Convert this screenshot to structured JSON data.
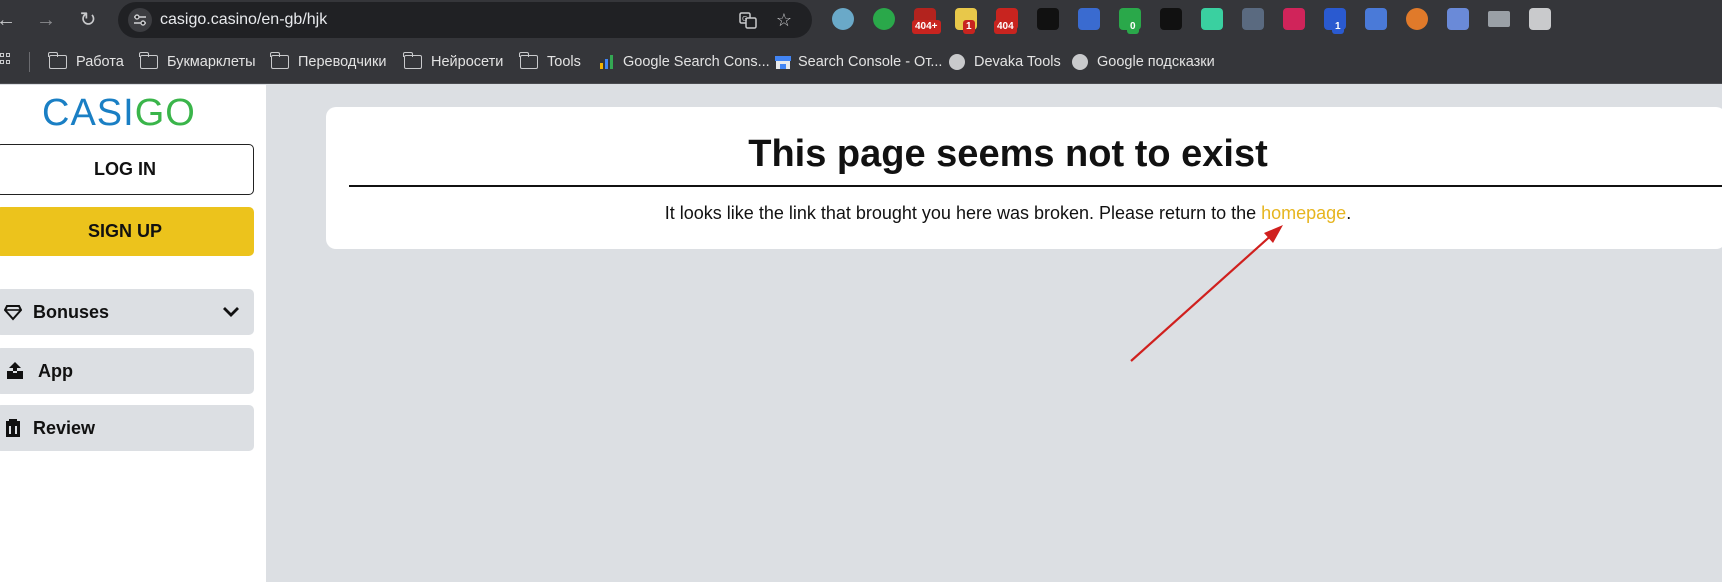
{
  "browser": {
    "url": "casigo.casino/en-gb/hjk",
    "extensions": [
      {
        "name": "ext-hex",
        "color": "#6aa9c8"
      },
      {
        "name": "ext-green-chart",
        "color": "#2aa84a"
      },
      {
        "name": "ext-404plus",
        "color": "#b3231e",
        "badge": "404+"
      },
      {
        "name": "ext-bulb",
        "color": "#e8c84a",
        "badge": "1"
      },
      {
        "name": "ext-404",
        "color": "#c8241f",
        "badge": "404"
      },
      {
        "name": "ext-mask",
        "color": "#111111"
      },
      {
        "name": "ext-magnet",
        "color": "#3a6bd0"
      },
      {
        "name": "ext-green-hook",
        "color": "#2aa84a",
        "badge": "0"
      },
      {
        "name": "ext-eyes",
        "color": "#111111"
      },
      {
        "name": "ext-pk",
        "color": "#3ad0a0"
      },
      {
        "name": "ext-mouse",
        "color": "#5a6a80"
      },
      {
        "name": "ext-shield-u",
        "color": "#d0245a"
      },
      {
        "name": "ext-shield-1",
        "color": "#2a5ad0",
        "badge": "1"
      },
      {
        "name": "ext-undo",
        "color": "#4a7ad8"
      },
      {
        "name": "ext-colorwheel",
        "color": "#e07a2a"
      },
      {
        "name": "ext-link",
        "color": "#6a8ad8"
      },
      {
        "name": "ext-mail",
        "color": "#9aa0a6"
      },
      {
        "name": "ext-puzzle",
        "color": "#c9cacc"
      }
    ]
  },
  "bookmarks": [
    {
      "label": "Работа",
      "icon": "folder-icon"
    },
    {
      "label": "Букмарклеты",
      "icon": "folder-icon"
    },
    {
      "label": "Переводчики",
      "icon": "folder-icon"
    },
    {
      "label": "Нейросети",
      "icon": "folder-icon"
    },
    {
      "label": "Tools",
      "icon": "folder-icon"
    },
    {
      "label": "Google Search Cons...",
      "icon": "search-console-icon"
    },
    {
      "label": "Search Console - От...",
      "icon": "store-icon"
    },
    {
      "label": "Devaka Tools",
      "icon": "globe-icon"
    },
    {
      "label": "Google подсказки",
      "icon": "globe-icon"
    }
  ],
  "sidebar": {
    "logo_left": "CASI",
    "logo_right": "GO",
    "login": "LOG IN",
    "signup": "SIGN UP",
    "menu": [
      {
        "label": "Bonuses",
        "icon": "diamond-icon"
      },
      {
        "label": "App",
        "icon": "upload-icon"
      },
      {
        "label": "Review",
        "icon": "clipboard-icon"
      }
    ]
  },
  "error": {
    "title": "This page seems not to exist",
    "message_before": "It looks like the link that brought you here was broken. Please return to the ",
    "link": "homepage",
    "message_after": "."
  },
  "colors": {
    "signup_bg": "#ecc31c",
    "link": "#e6b520",
    "logo_blue": "#1a7fc4",
    "logo_green": "#3ab54a",
    "annotation_arrow": "#d0201e"
  }
}
